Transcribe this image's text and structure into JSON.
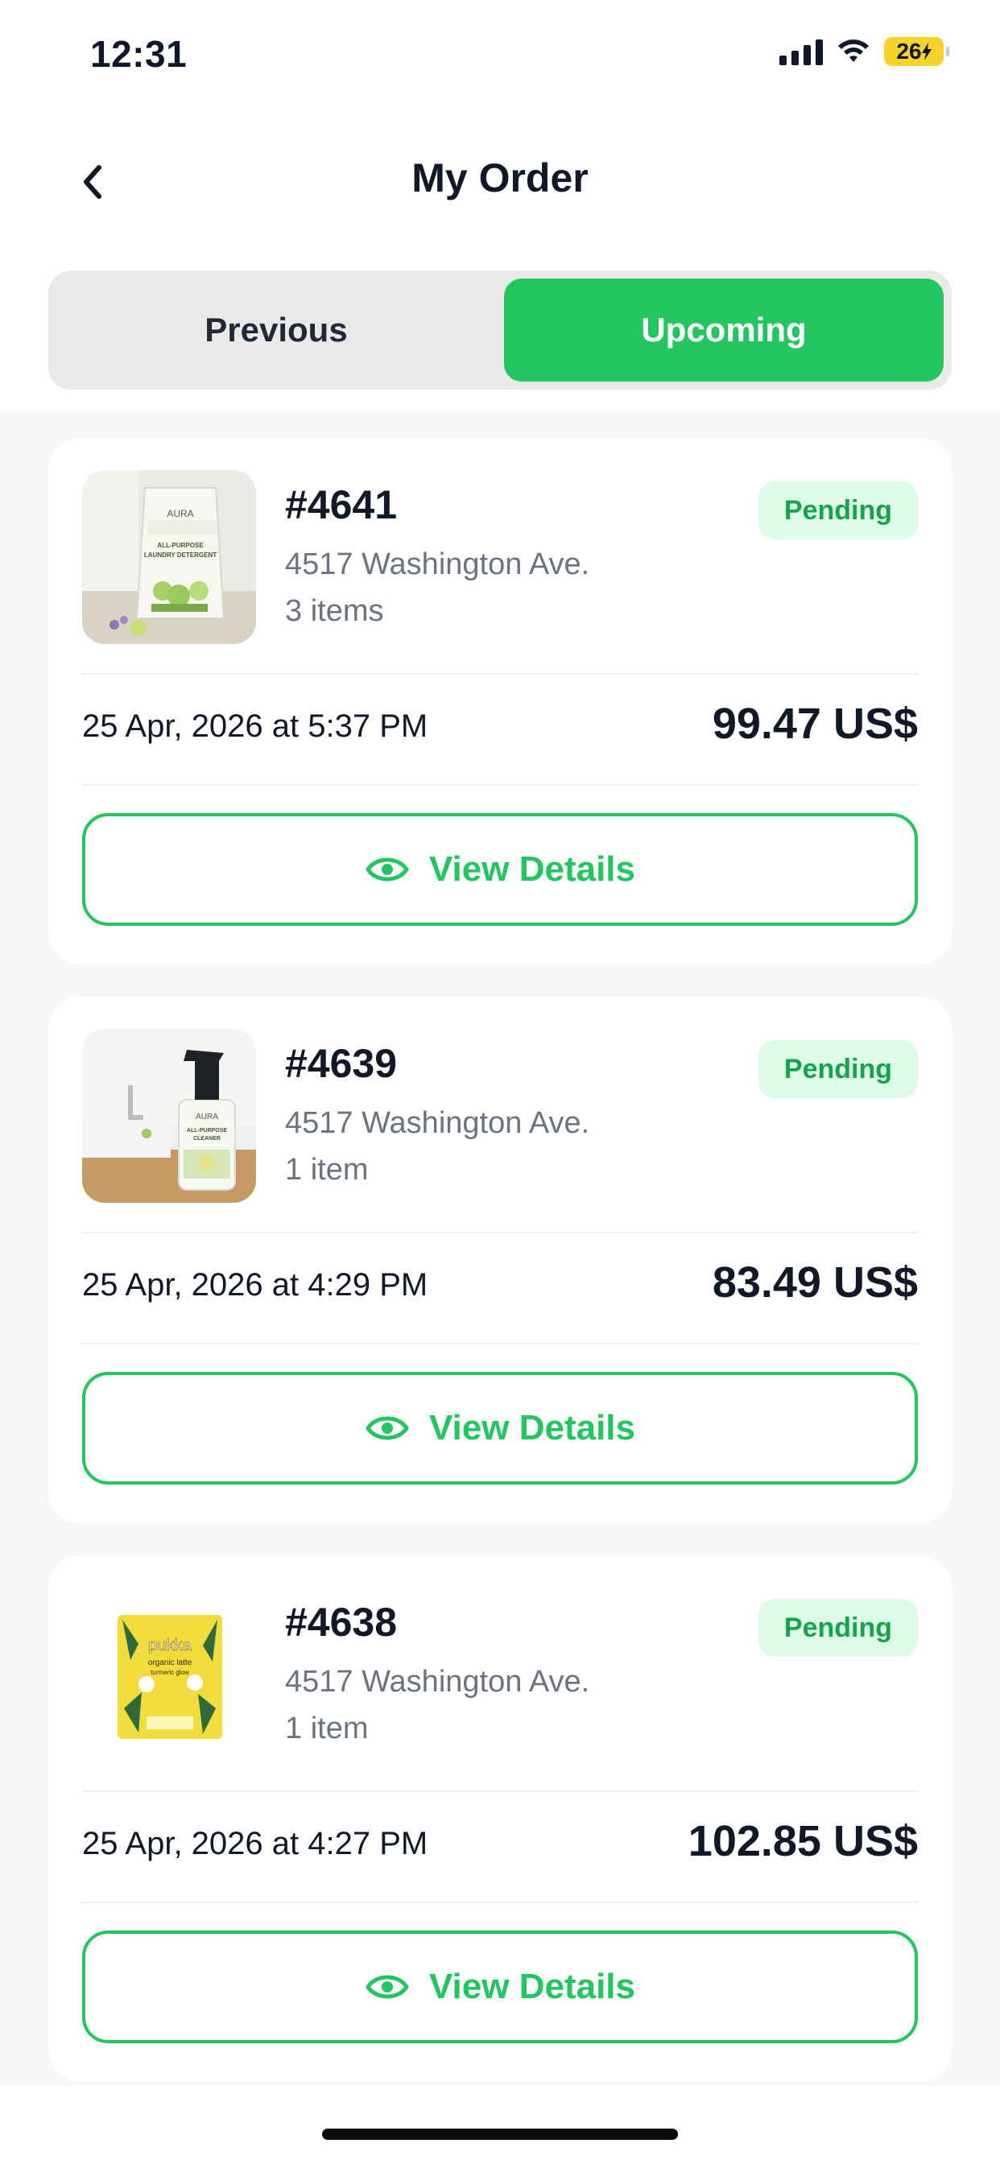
{
  "status_bar": {
    "time": "12:31",
    "battery": "26",
    "icons": [
      "signal-icon",
      "wifi-icon",
      "battery-icon"
    ]
  },
  "header": {
    "title": "My Order",
    "back_icon": "chevron-left-icon"
  },
  "tabs": [
    {
      "label": "Previous",
      "active": false
    },
    {
      "label": "Upcoming",
      "active": true
    }
  ],
  "colors": {
    "accent": "#22c55e",
    "badge_bg": "#dcfce7",
    "badge_text": "#16a34a",
    "muted": "#6b7280",
    "text": "#111827"
  },
  "orders": [
    {
      "id": "#4641",
      "address": "4517 Washington Ave.",
      "items": "3 items",
      "status": "Pending",
      "date": "25 Apr, 2026 at 5:37 PM",
      "total": "99.47 US$",
      "button_label": "View Details",
      "image_text": [
        "AURA",
        "ALL-PURPOSE",
        "LAUNDRY DETERGENT"
      ]
    },
    {
      "id": "#4639",
      "address": "4517 Washington Ave.",
      "items": "1 item",
      "status": "Pending",
      "date": "25 Apr, 2026 at 4:29 PM",
      "total": "83.49 US$",
      "button_label": "View Details",
      "image_text": [
        "AURA",
        "ALL-PURPOSE",
        "CLEANER"
      ]
    },
    {
      "id": "#4638",
      "address": "4517 Washington Ave.",
      "items": "1 item",
      "status": "Pending",
      "date": "25 Apr, 2026 at 4:27 PM",
      "total": "102.85 US$",
      "button_label": "View Details",
      "image_text": [
        "pukka",
        "organic latte",
        "turmeric glow"
      ]
    }
  ]
}
